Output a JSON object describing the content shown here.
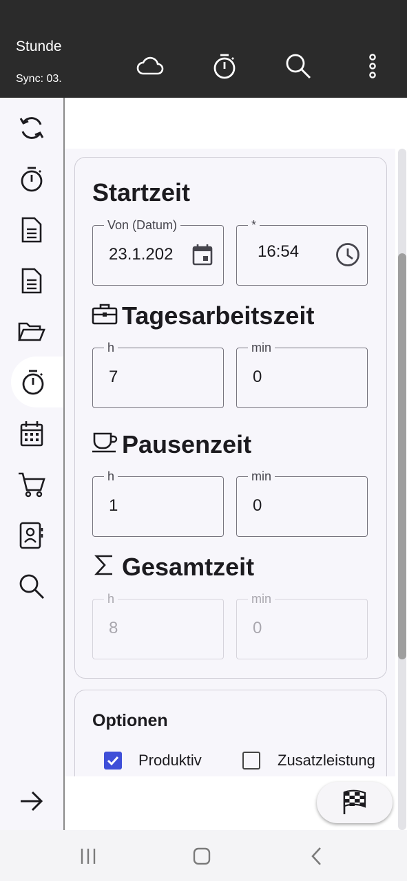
{
  "appbar": {
    "title": "Stunde",
    "sync": "Sync: 03.",
    "actions": [
      "cloud-icon",
      "timer-icon",
      "search-icon",
      "more-vert-icon"
    ]
  },
  "rail": {
    "items": [
      "sync-icon",
      "timer-icon",
      "document-icon",
      "document-icon",
      "folder-open-icon",
      "timer-icon",
      "calendar-icon",
      "cart-icon",
      "contacts-icon",
      "search-icon"
    ],
    "active_index": 5,
    "bottom": "arrow-right-icon"
  },
  "start": {
    "title": "Startzeit",
    "date_label": "Von (Datum)",
    "date_value": "23.1.202",
    "time_label": "*",
    "time_value": "16:54"
  },
  "work": {
    "title": "Tagesarbeitszeit",
    "icon": "briefcase-icon",
    "h_label": "h",
    "h_value": "7",
    "min_label": "min",
    "min_value": "0"
  },
  "pause": {
    "title": "Pausenzeit",
    "icon": "coffee-cup-icon",
    "h_label": "h",
    "h_value": "1",
    "min_label": "min",
    "min_value": "0"
  },
  "total": {
    "title": "Gesamtzeit",
    "icon": "sigma-icon",
    "h_label": "h",
    "h_value": "8",
    "min_label": "min",
    "min_value": "0"
  },
  "options": {
    "title": "Optionen",
    "productive_label": "Produktiv",
    "productive_checked": true,
    "extra_label": "Zusatzleistung",
    "extra_checked": false
  },
  "fab": {
    "icon": "checkered-flag-icon"
  },
  "navbar": [
    "recent-apps-icon",
    "home-icon",
    "back-icon"
  ],
  "colors": {
    "appbar": "#2b2b2b",
    "accent": "#3f4fd8",
    "surface": "#f7f6fb"
  }
}
